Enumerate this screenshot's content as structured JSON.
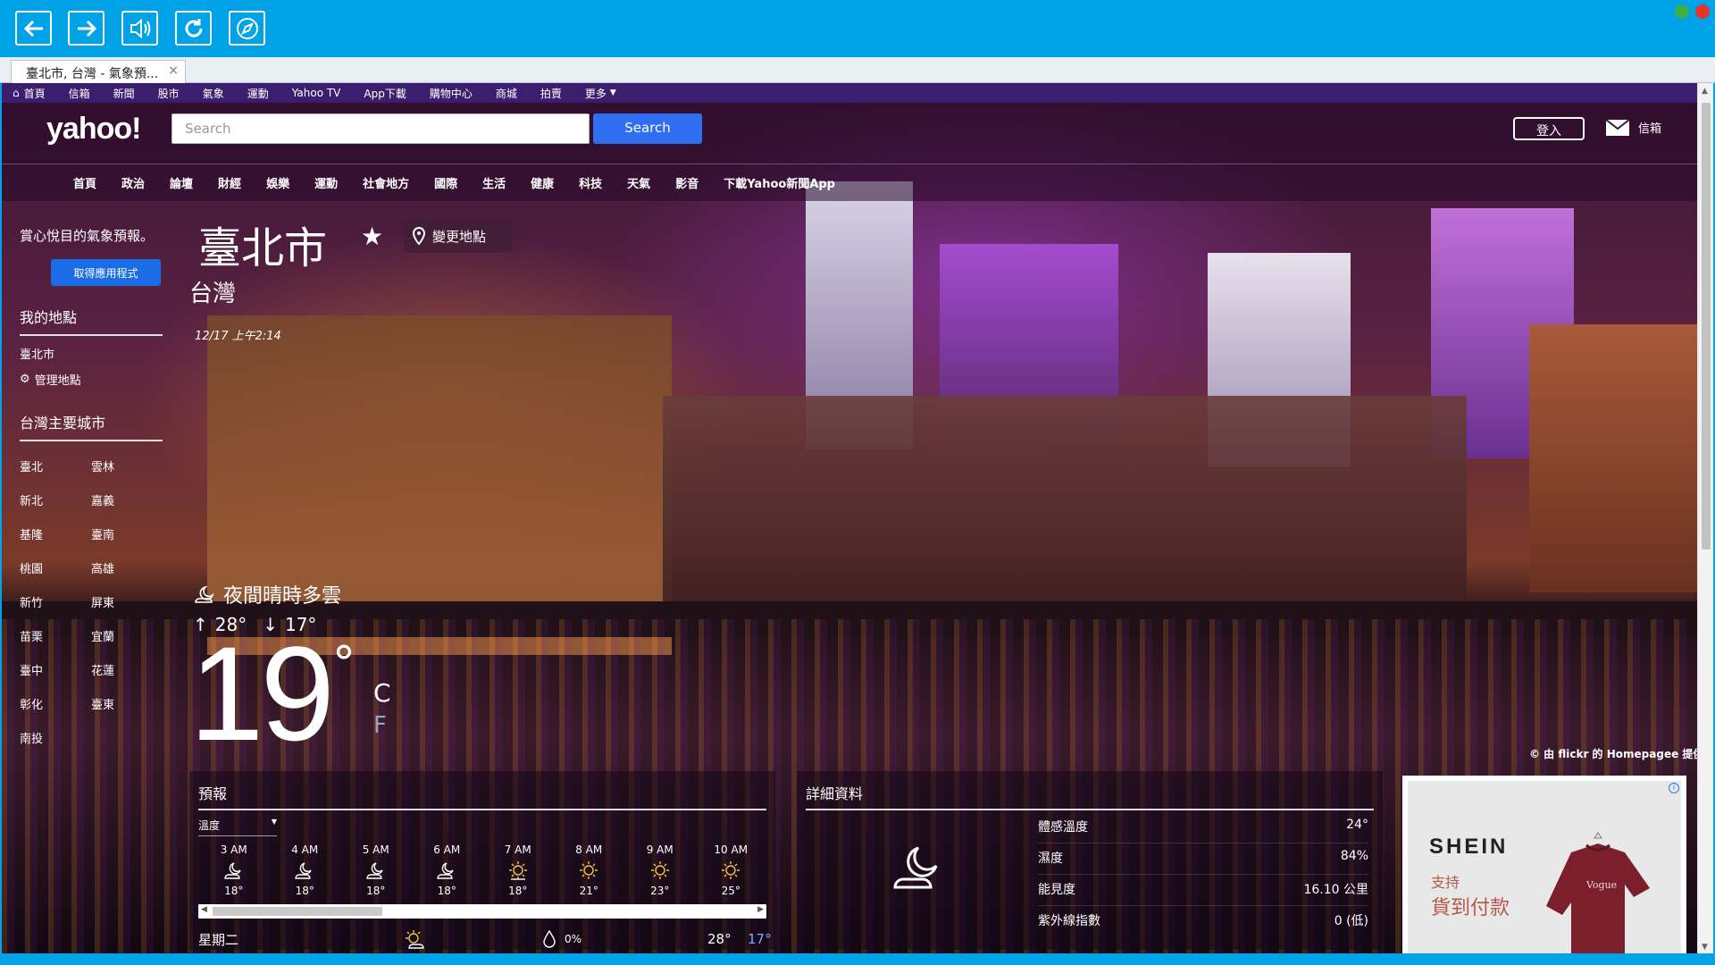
{
  "browser": {
    "tab_title": "臺北市, 台灣 - 氣象預...",
    "tab_close": "×"
  },
  "ynav": {
    "items": [
      "首頁",
      "信箱",
      "新聞",
      "股市",
      "氣象",
      "運動",
      "Yahoo TV",
      "App下載",
      "購物中心",
      "商城",
      "拍賣",
      "更多"
    ]
  },
  "header": {
    "logo": "yahoo!",
    "search_placeholder": "Search",
    "search_button": "Search",
    "login": "登入",
    "mail": "信箱"
  },
  "subnav": {
    "items": [
      "首頁",
      "政治",
      "論壇",
      "財經",
      "娛樂",
      "運動",
      "社會地方",
      "國際",
      "生活",
      "健康",
      "科技",
      "天氣",
      "影音",
      "下載Yahoo新聞App"
    ]
  },
  "sidebar": {
    "promo": "賞心悅目的氣象預報。",
    "get_app": "取得應用程式",
    "my_places": "我的地點",
    "my_place_city": "臺北市",
    "manage_places": "管理地點",
    "major_cities": "台灣主要城市",
    "cities_left": [
      "臺北",
      "新北",
      "基隆",
      "桃園",
      "新竹",
      "苗栗",
      "臺中",
      "彰化",
      "南投"
    ],
    "cities_right": [
      "雲林",
      "嘉義",
      "臺南",
      "高雄",
      "屏東",
      "宜蘭",
      "花蓮",
      "臺東"
    ]
  },
  "location": {
    "city": "臺北市",
    "country": "台灣",
    "change_location": "變更地點",
    "datetime": "12/17 上午2:14"
  },
  "current": {
    "condition": "夜間晴時多雲",
    "high": "28°",
    "low": "17°",
    "temp": "19",
    "deg": "°",
    "unit_c": "C",
    "unit_f": "F",
    "photo_credit": "© 由 flickr 的 Homepagee 提供"
  },
  "forecast": {
    "title": "預報",
    "select": "溫度",
    "hours": [
      {
        "time": "3 AM",
        "temp": "18°",
        "icon": "moon-cloud-icon"
      },
      {
        "time": "4 AM",
        "temp": "18°",
        "icon": "moon-cloud-icon"
      },
      {
        "time": "5 AM",
        "temp": "18°",
        "icon": "moon-cloud-icon"
      },
      {
        "time": "6 AM",
        "temp": "18°",
        "icon": "moon-cloud-icon"
      },
      {
        "time": "7 AM",
        "temp": "18°",
        "icon": "sun-cloud-icon"
      },
      {
        "time": "8 AM",
        "temp": "21°",
        "icon": "sun-icon"
      },
      {
        "time": "9 AM",
        "temp": "23°",
        "icon": "sun-icon"
      },
      {
        "time": "10 AM",
        "temp": "25°",
        "icon": "sun-icon"
      }
    ],
    "day": "星期二",
    "precip": "0%",
    "day_high": "28°",
    "day_low": "17°"
  },
  "details": {
    "title": "詳細資料",
    "rows": [
      {
        "label": "體感溫度",
        "value": "24°"
      },
      {
        "label": "濕度",
        "value": "84%"
      },
      {
        "label": "能見度",
        "value": "16.10 公里"
      },
      {
        "label": "紫外線指數",
        "value": "0 (低)"
      }
    ]
  },
  "ad": {
    "brand": "SHEIN",
    "line1": "支持",
    "line2": "貨到付款",
    "info": "i"
  },
  "colors": {
    "chrome": "#00a2e8",
    "yahoo_nav": "#3c1e6e",
    "search_button": "#2f6df2",
    "get_app": "#1b6de5"
  }
}
